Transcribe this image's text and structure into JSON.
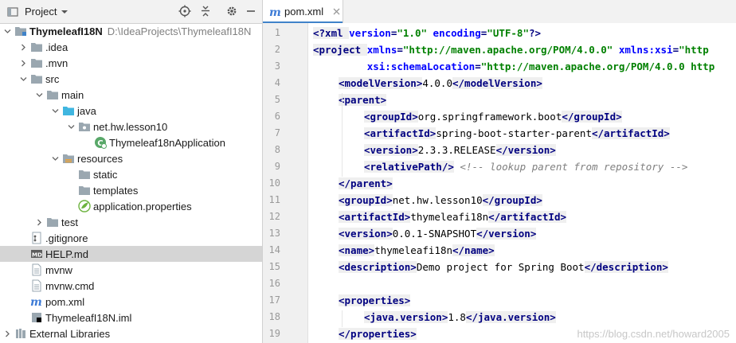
{
  "project_panel": {
    "title": "Project",
    "tree": [
      {
        "depth": 0,
        "arrow": "down",
        "icon": "module-folder",
        "label": "ThymeleafI18N",
        "path": "D:\\IdeaProjects\\ThymeleafI18N",
        "bold": true
      },
      {
        "depth": 1,
        "arrow": "right",
        "icon": "folder",
        "label": ".idea"
      },
      {
        "depth": 1,
        "arrow": "right",
        "icon": "folder",
        "label": ".mvn"
      },
      {
        "depth": 1,
        "arrow": "down",
        "icon": "folder",
        "label": "src"
      },
      {
        "depth": 2,
        "arrow": "down",
        "icon": "folder",
        "label": "main"
      },
      {
        "depth": 3,
        "arrow": "down",
        "icon": "source-folder",
        "label": "java"
      },
      {
        "depth": 4,
        "arrow": "down",
        "icon": "package",
        "label": "net.hw.lesson10"
      },
      {
        "depth": 5,
        "arrow": "",
        "icon": "spring-class",
        "label": "Thymeleaf18nApplication"
      },
      {
        "depth": 3,
        "arrow": "down",
        "icon": "resources-folder",
        "label": "resources"
      },
      {
        "depth": 4,
        "arrow": "",
        "icon": "folder",
        "label": "static"
      },
      {
        "depth": 4,
        "arrow": "",
        "icon": "folder",
        "label": "templates"
      },
      {
        "depth": 4,
        "arrow": "",
        "icon": "properties",
        "label": "application.properties"
      },
      {
        "depth": 2,
        "arrow": "right",
        "icon": "folder",
        "label": "test"
      },
      {
        "depth": 1,
        "arrow": "",
        "icon": "gitignore",
        "label": ".gitignore"
      },
      {
        "depth": 1,
        "arrow": "",
        "icon": "markdown",
        "label": "HELP.md",
        "selected": true
      },
      {
        "depth": 1,
        "arrow": "",
        "icon": "file",
        "label": "mvnw"
      },
      {
        "depth": 1,
        "arrow": "",
        "icon": "file",
        "label": "mvnw.cmd"
      },
      {
        "depth": 1,
        "arrow": "",
        "icon": "maven",
        "label": "pom.xml"
      },
      {
        "depth": 1,
        "arrow": "",
        "icon": "iml",
        "label": "ThymeleafI18N.iml"
      },
      {
        "depth": 0,
        "arrow": "right",
        "icon": "libraries",
        "label": "External Libraries"
      }
    ]
  },
  "editor": {
    "tab_label": "pom.xml",
    "watermark": "https://blog.csdn.net/howard2005",
    "lines": [
      {
        "n": "1",
        "indent": 0,
        "segs": [
          [
            "tag",
            "<?xml "
          ],
          [
            "attr",
            "version"
          ],
          [
            "tag",
            "="
          ],
          [
            "str",
            "\"1.0\""
          ],
          [
            "tag",
            " "
          ],
          [
            "attr",
            "encoding"
          ],
          [
            "tag",
            "="
          ],
          [
            "str",
            "\"UTF-8\""
          ],
          [
            "tag",
            "?>"
          ]
        ]
      },
      {
        "n": "2",
        "indent": 0,
        "segs": [
          [
            "tag",
            "<project "
          ],
          [
            "attr",
            "xmlns"
          ],
          [
            "tag",
            "="
          ],
          [
            "str",
            "\"http://maven.apache.org/POM/4.0.0\""
          ],
          [
            "tag",
            " "
          ],
          [
            "attr",
            "xmlns:xsi"
          ],
          [
            "tag",
            "="
          ],
          [
            "str",
            "\"http"
          ]
        ]
      },
      {
        "n": "3",
        "indent": 0,
        "segs": [
          [
            "tag",
            "         "
          ],
          [
            "attr",
            "xsi:schemaLocation"
          ],
          [
            "tag",
            "="
          ],
          [
            "str",
            "\"http://maven.apache.org/POM/4.0.0 http"
          ]
        ]
      },
      {
        "n": "4",
        "indent": 1,
        "segs": [
          [
            "tag",
            "<modelVersion>"
          ],
          [
            "txt",
            "4.0.0"
          ],
          [
            "tag",
            "</modelVersion>"
          ]
        ]
      },
      {
        "n": "5",
        "indent": 1,
        "segs": [
          [
            "tag",
            "<parent>"
          ]
        ]
      },
      {
        "n": "6",
        "indent": 2,
        "segs": [
          [
            "tag",
            "<groupId>"
          ],
          [
            "txt",
            "org.springframework.boot"
          ],
          [
            "tag",
            "</groupId>"
          ]
        ]
      },
      {
        "n": "7",
        "indent": 2,
        "segs": [
          [
            "tag",
            "<artifactId>"
          ],
          [
            "txt",
            "spring-boot-starter-parent"
          ],
          [
            "tag",
            "</artifactId>"
          ]
        ]
      },
      {
        "n": "8",
        "indent": 2,
        "segs": [
          [
            "tag",
            "<version>"
          ],
          [
            "txt",
            "2.3.3.RELEASE"
          ],
          [
            "tag",
            "</version>"
          ]
        ]
      },
      {
        "n": "9",
        "indent": 2,
        "segs": [
          [
            "tag",
            "<relativePath/>"
          ],
          [
            "txt",
            " "
          ],
          [
            "cmt",
            "<!-- lookup parent from repository -->"
          ]
        ]
      },
      {
        "n": "10",
        "indent": 1,
        "segs": [
          [
            "tag",
            "</parent>"
          ]
        ]
      },
      {
        "n": "11",
        "indent": 1,
        "segs": [
          [
            "tag",
            "<groupId>"
          ],
          [
            "txt",
            "net.hw.lesson10"
          ],
          [
            "tag",
            "</groupId>"
          ]
        ]
      },
      {
        "n": "12",
        "indent": 1,
        "segs": [
          [
            "tag",
            "<artifactId>"
          ],
          [
            "txt",
            "thymeleafi18n"
          ],
          [
            "tag",
            "</artifactId>"
          ]
        ]
      },
      {
        "n": "13",
        "indent": 1,
        "segs": [
          [
            "tag",
            "<version>"
          ],
          [
            "txt",
            "0.0.1-SNAPSHOT"
          ],
          [
            "tag",
            "</version>"
          ]
        ]
      },
      {
        "n": "14",
        "indent": 1,
        "segs": [
          [
            "tag",
            "<name>"
          ],
          [
            "txt",
            "thymeleafi18n"
          ],
          [
            "tag",
            "</name>"
          ]
        ]
      },
      {
        "n": "15",
        "indent": 1,
        "segs": [
          [
            "tag",
            "<description>"
          ],
          [
            "txt",
            "Demo project for Spring Boot"
          ],
          [
            "tag",
            "</description>"
          ]
        ]
      },
      {
        "n": "16",
        "indent": 0,
        "segs": []
      },
      {
        "n": "17",
        "indent": 1,
        "segs": [
          [
            "tag",
            "<properties>"
          ]
        ]
      },
      {
        "n": "18",
        "indent": 2,
        "segs": [
          [
            "tag",
            "<java.version>"
          ],
          [
            "txt",
            "1.8"
          ],
          [
            "tag",
            "</java.version>"
          ]
        ]
      },
      {
        "n": "19",
        "indent": 1,
        "segs": [
          [
            "tag",
            "</properties>"
          ]
        ]
      }
    ]
  },
  "colors": {
    "accent": "#4083c9",
    "tag": "#000080",
    "attr": "#0000ff",
    "string": "#008000",
    "comment": "#808080",
    "selection": "#d5d5d5"
  }
}
